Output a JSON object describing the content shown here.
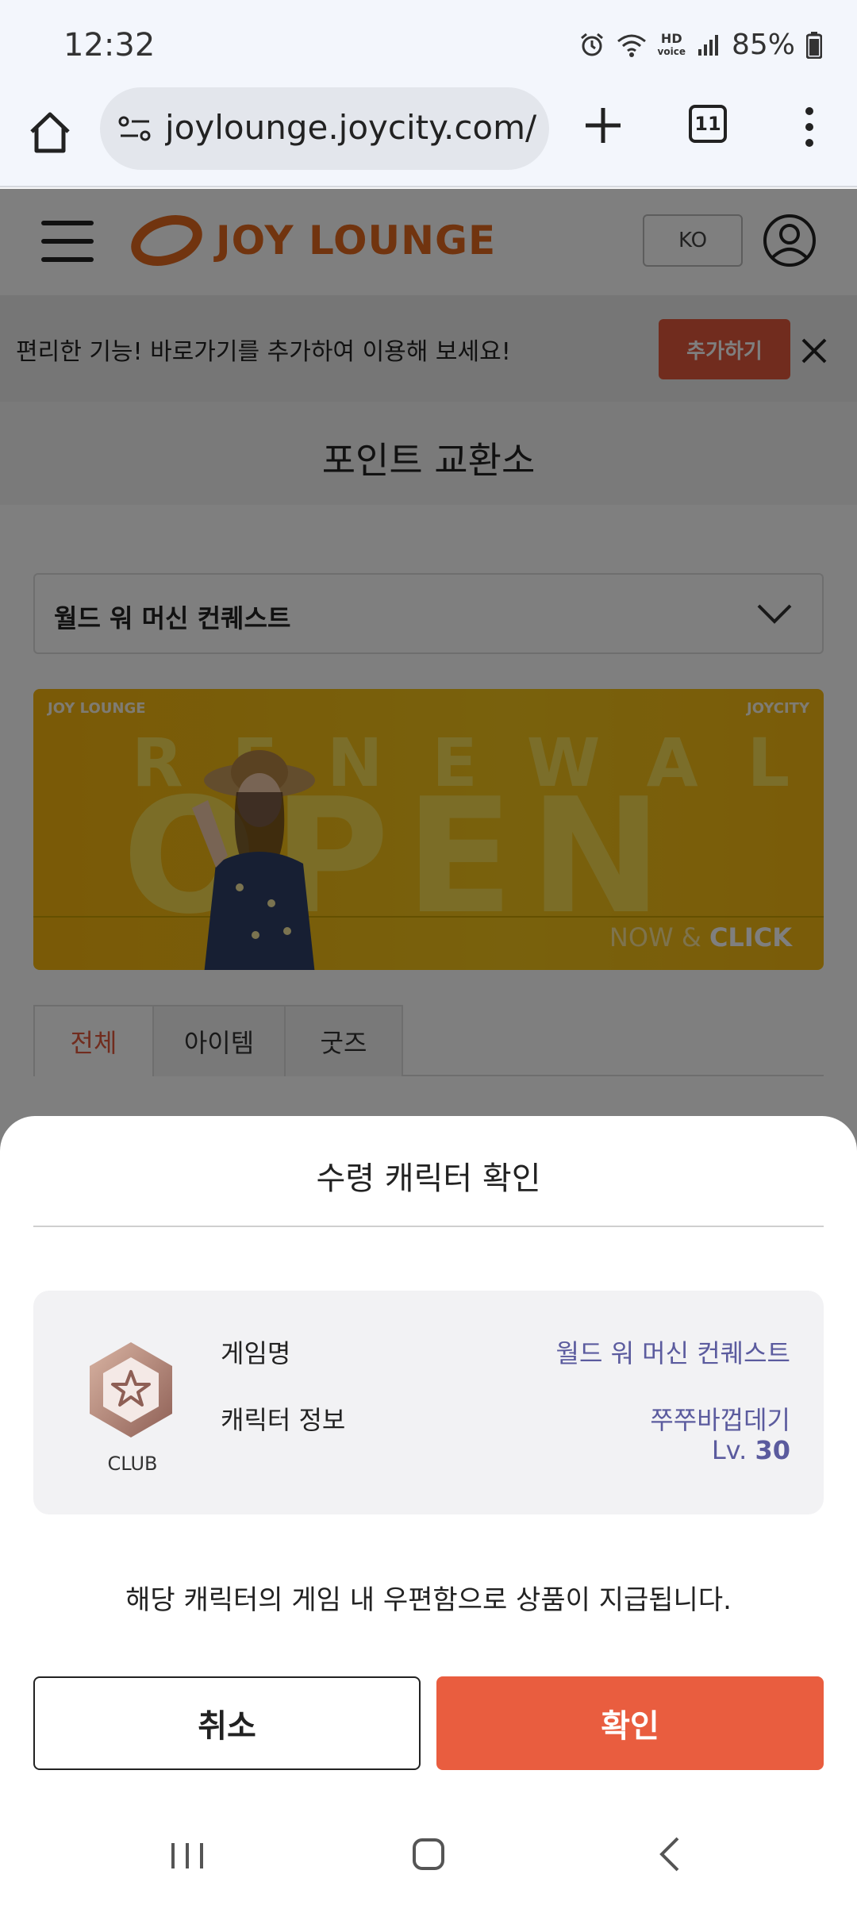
{
  "status_bar": {
    "time": "12:32",
    "battery": "85%",
    "hd_label": "HD",
    "voice_label": "voice"
  },
  "browser": {
    "url": "joylounge.joycity.com/k",
    "tab_count": "11"
  },
  "site": {
    "logo": "JOY LOUNGE",
    "language": "KO",
    "shortcut_text": "편리한 기능! 바로가기를 추가하여 이용해 보세요!",
    "shortcut_add": "추가하기",
    "page_title": "포인트 교환소",
    "game_select": "월드 워 머신 컨퀘스트",
    "banner": {
      "logo_left": "JOY LOUNGE",
      "logo_right": "JOYCITY",
      "renewal": "RENEWAL",
      "open": "OPEN",
      "cta_plain": "NOW & ",
      "cta_bold": "CLICK"
    },
    "tabs": [
      "전체",
      "아이템",
      "굿즈"
    ]
  },
  "sheet": {
    "title": "수령 캐릭터 확인",
    "badge_label": "CLUB",
    "game_name_label": "게임명",
    "game_name_value": "월드 워 머신 컨퀘스트",
    "character_label": "캐릭터 정보",
    "character_name": "쭈쭈바껍데기",
    "level_prefix": "Lv. ",
    "level_value": "30",
    "notice": "해당 캐릭터의 게임 내 우편함으로 상품이 지급됩니다.",
    "cancel": "취소",
    "confirm": "확인"
  },
  "colors": {
    "accent": "#e95d3f",
    "brand": "#e2681f",
    "value_text": "#5b5b9e"
  }
}
